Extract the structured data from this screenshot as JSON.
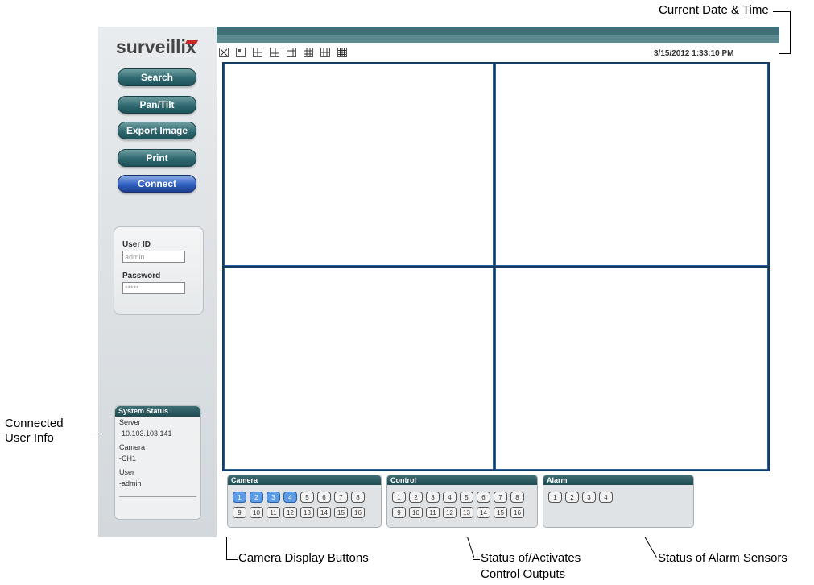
{
  "annotations": {
    "current_date_time": "Current Date & Time",
    "connected_user_info_line1": "Connected",
    "connected_user_info_line2": "User Info",
    "camera_display_buttons": "Camera Display Buttons",
    "status_control_line1": "Status of/Activates",
    "status_control_line2": "Control Outputs",
    "status_alarm_sensors": "Status of Alarm Sensors"
  },
  "sidebar": {
    "logo": "surveillix",
    "buttons": [
      "Search",
      "Pan/Tilt",
      "Export Image",
      "Print",
      "Connect"
    ],
    "login": {
      "user_id_label": "User ID",
      "user_id_value": "admin",
      "password_label": "Password",
      "password_value": "*****"
    },
    "system_status": {
      "title": "System Status",
      "server_label": "Server",
      "server_value": "-10.103.103.141",
      "camera_label": "Camera",
      "camera_value": "-CH1",
      "user_label": "User",
      "user_value": "-admin"
    }
  },
  "toolbar": {
    "layout_icons": [
      "close-icon",
      "layout-1-icon",
      "layout-4-icon",
      "layout-6-icon",
      "layout-8-icon",
      "layout-9-icon",
      "layout-10-icon",
      "layout-16-icon"
    ],
    "datetime": "3/15/2012   1:33:10 PM"
  },
  "panels": {
    "camera": {
      "title": "Camera",
      "buttons": [
        "1",
        "2",
        "3",
        "4",
        "5",
        "6",
        "7",
        "8",
        "9",
        "10",
        "11",
        "12",
        "13",
        "14",
        "15",
        "16"
      ],
      "active": [
        1,
        2,
        3,
        4
      ]
    },
    "control": {
      "title": "Control",
      "buttons": [
        "1",
        "2",
        "3",
        "4",
        "5",
        "6",
        "7",
        "8",
        "9",
        "10",
        "11",
        "12",
        "13",
        "14",
        "15",
        "16"
      ]
    },
    "alarm": {
      "title": "Alarm",
      "buttons": [
        "1",
        "2",
        "3",
        "4"
      ]
    }
  },
  "colors": {
    "accent_teal": "#2f6870",
    "active_blue": "#2f5fc1",
    "grid_border": "#123c62"
  }
}
